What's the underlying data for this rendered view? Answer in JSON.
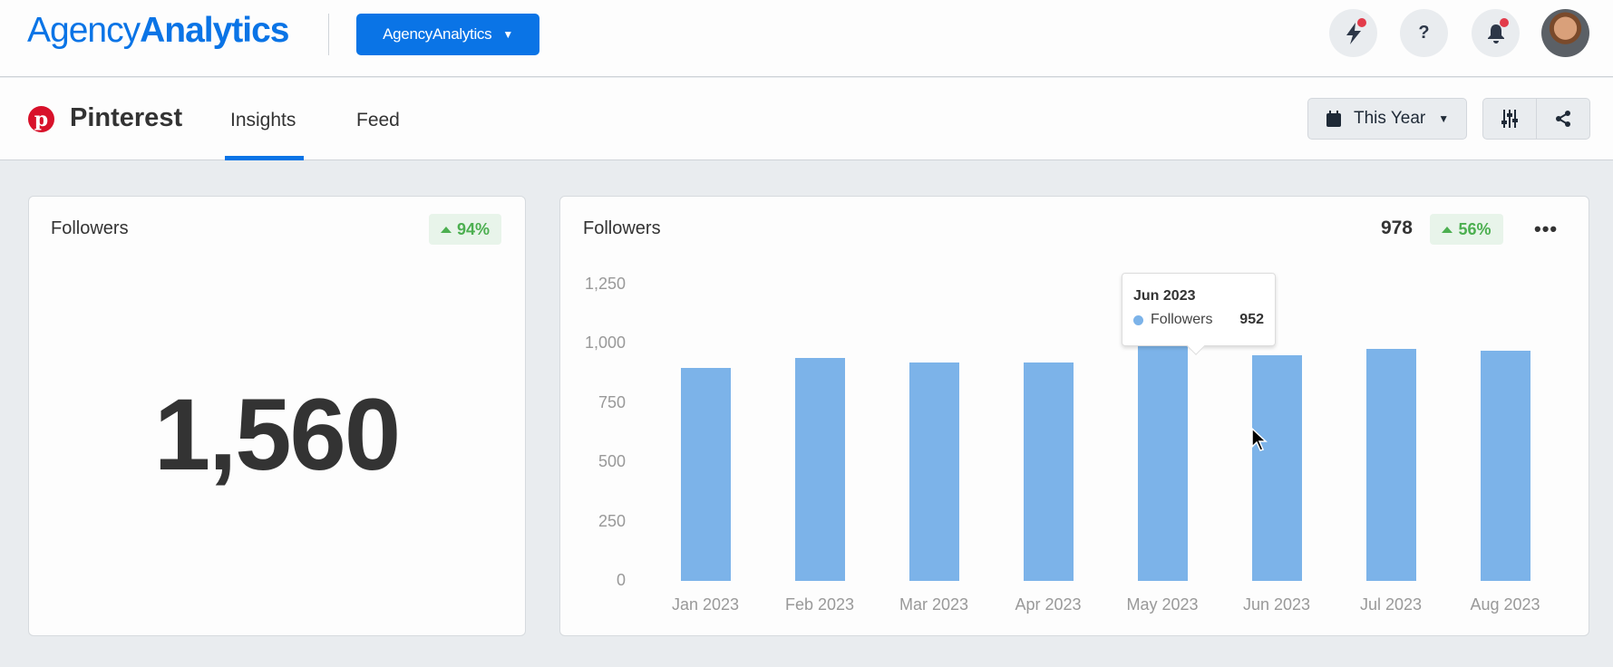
{
  "header": {
    "logo_light": "Agency",
    "logo_bold": "Analytics",
    "account_dropdown": "AgencyAnalytics",
    "icons": [
      "lightning-icon",
      "help-icon",
      "bell-icon",
      "avatar"
    ],
    "help_glyph": "?"
  },
  "subheader": {
    "integration": "Pinterest",
    "pin_glyph": "p",
    "tabs": [
      {
        "label": "Insights",
        "active": true
      },
      {
        "label": "Feed",
        "active": false
      }
    ],
    "date_range": "This Year"
  },
  "summary_card": {
    "title": "Followers",
    "change": "94%",
    "value": "1,560"
  },
  "chart_card": {
    "title": "Followers",
    "total": "978",
    "change": "56%",
    "tooltip": {
      "title": "Jun 2023",
      "series": "Followers",
      "value": "952"
    }
  },
  "colors": {
    "brand": "#0a74e6",
    "bar": "#7cb3e9",
    "positive": "#4caf50",
    "pinterest": "#d8112a"
  },
  "chart_data": {
    "type": "bar",
    "title": "Followers",
    "categories": [
      "Jan 2023",
      "Feb 2023",
      "Mar 2023",
      "Apr 2023",
      "May 2023",
      "Jun 2023",
      "Jul 2023",
      "Aug 2023"
    ],
    "series": [
      {
        "name": "Followers",
        "values": [
          898,
          942,
          920,
          920,
          1010,
          952,
          978,
          972
        ]
      }
    ],
    "yticks": [
      "0",
      "250",
      "500",
      "750",
      "1,000",
      "1,250"
    ],
    "ylim": [
      0,
      1250
    ],
    "grid": false,
    "legend": "none"
  }
}
